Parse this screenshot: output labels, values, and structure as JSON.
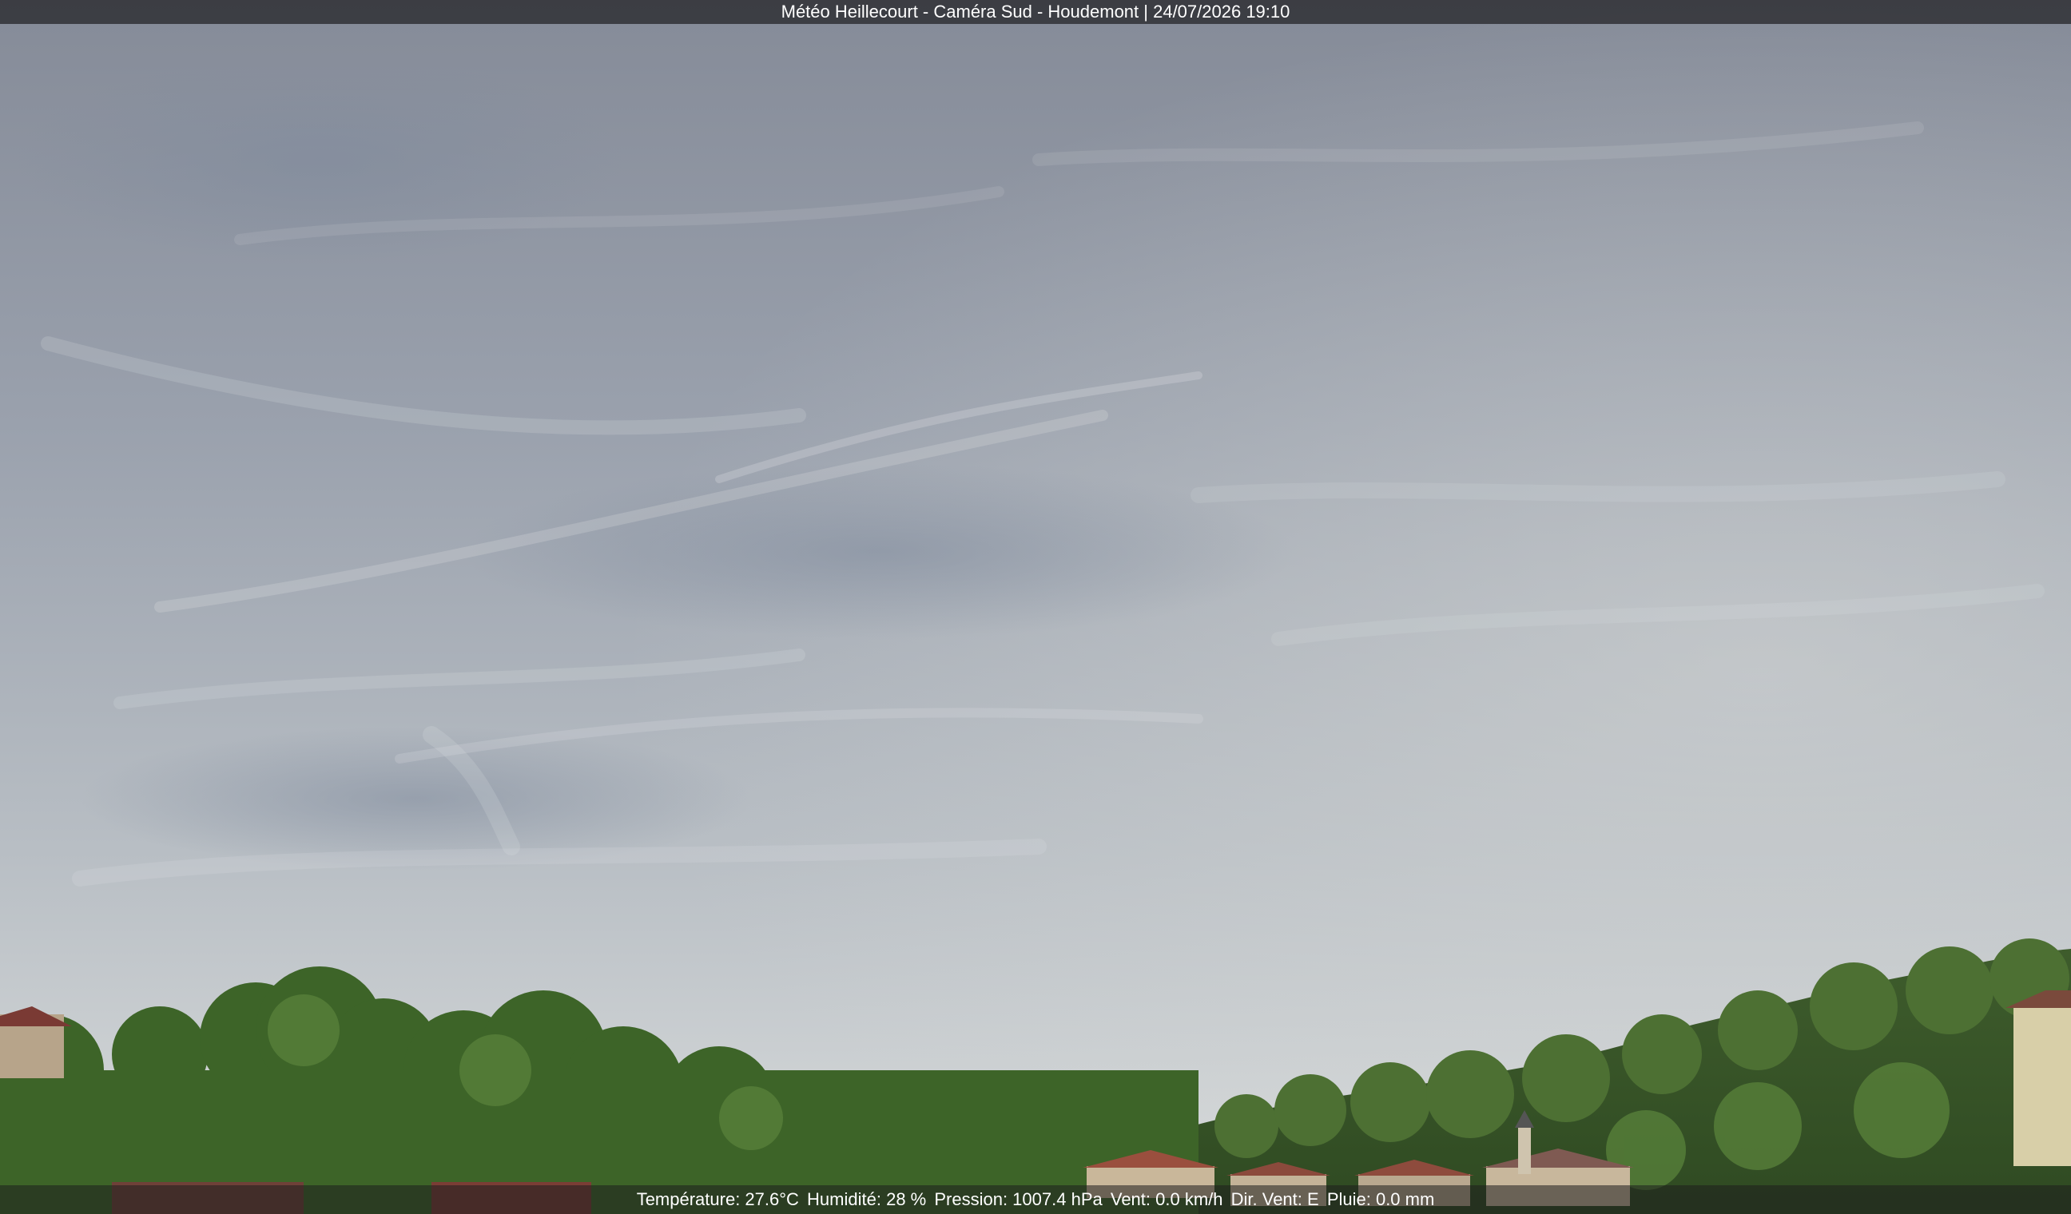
{
  "camera": {
    "title": "Météo Heillecourt - Caméra Sud - Houdemont | 24/07/2026 19:10"
  },
  "weather": {
    "temperature": "Température: 27.6°C",
    "humidity": "Humidité: 28 %",
    "pressure": "Pression: 1007.4 hPa",
    "wind": "Vent: 0.0 km/h",
    "wind_direction": "Dir. Vent: E",
    "rain": "Pluie: 0.0 mm"
  },
  "colors": {
    "sky_top": "#8a909c",
    "sky_horizon": "#d7dbdc",
    "foliage": "#3f6a2a",
    "roofs": "#8b4a3c"
  }
}
